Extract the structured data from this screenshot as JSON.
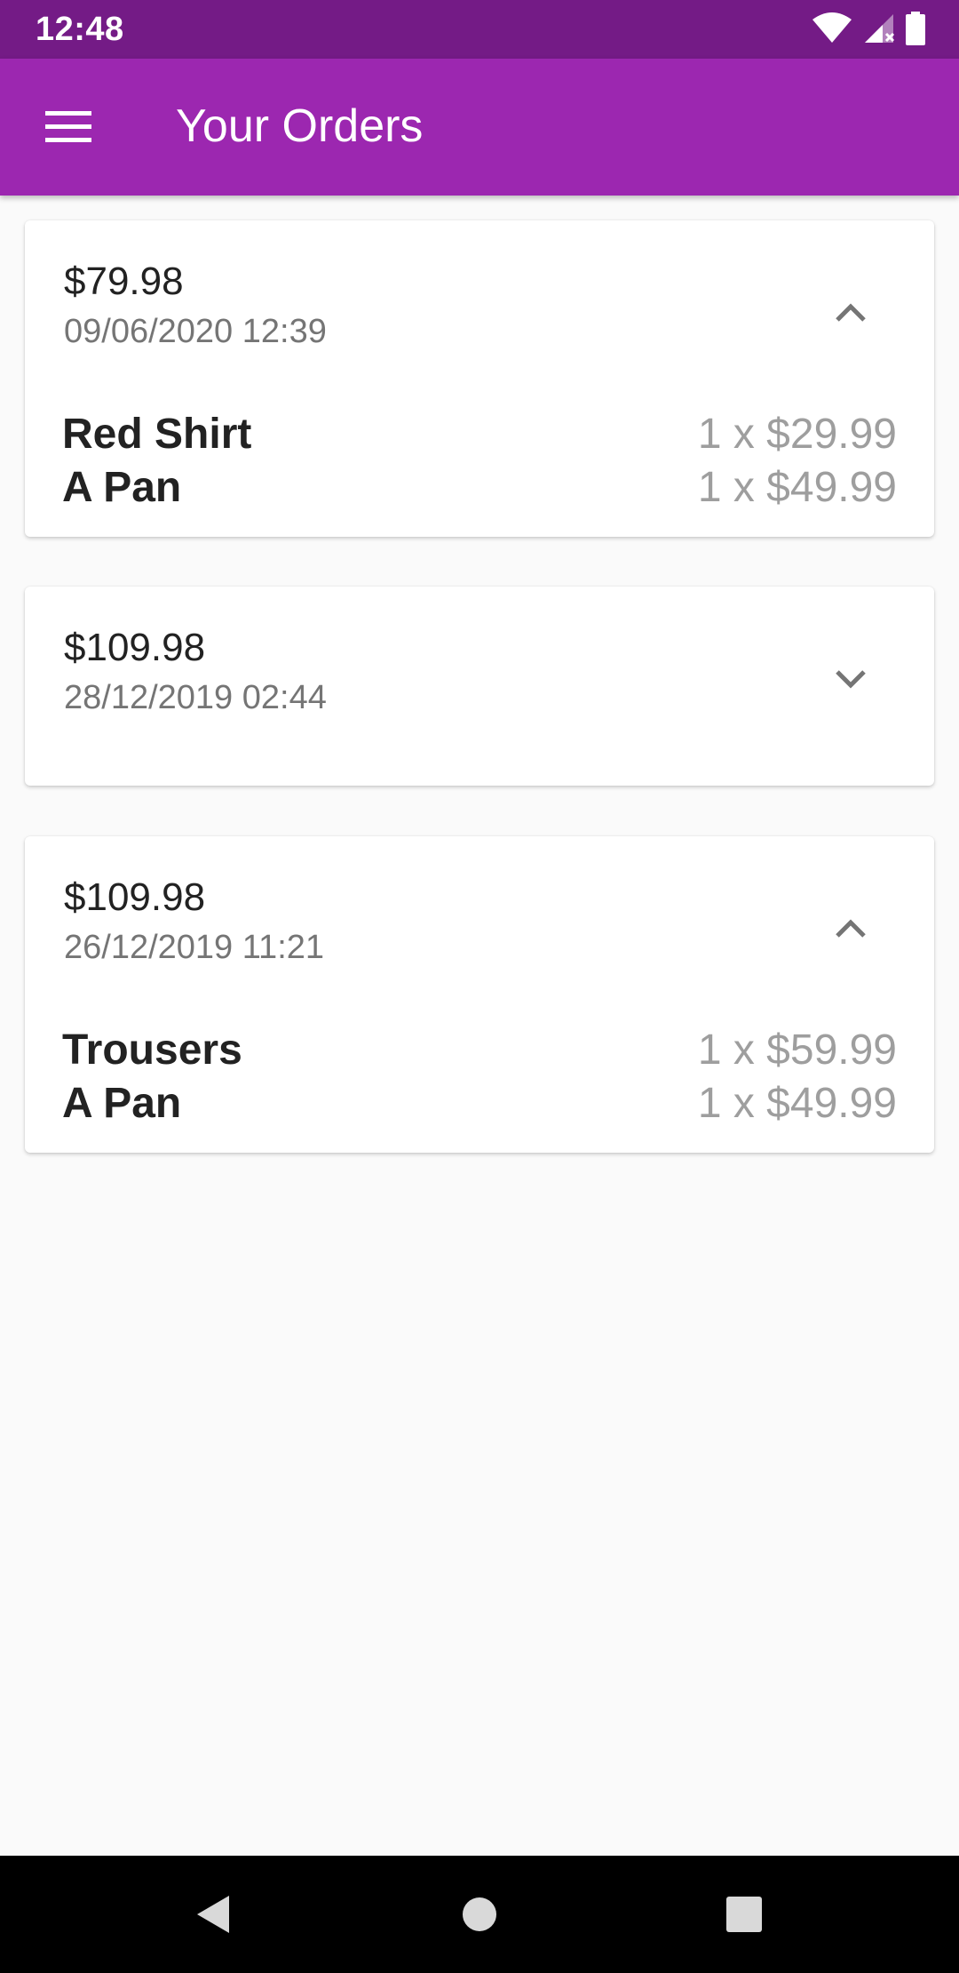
{
  "status_bar": {
    "time": "12:48",
    "icons": [
      "wifi-icon",
      "cell-signal-icon",
      "battery-icon"
    ]
  },
  "app_bar": {
    "title": "Your Orders",
    "menu_icon": "hamburger-menu-icon"
  },
  "colors": {
    "status_bar": "#741b86",
    "app_bar": "#9c27b0",
    "background": "#fafafa"
  },
  "orders": [
    {
      "total": "$79.98",
      "date": "09/06/2020 12:39",
      "expanded": true,
      "toggle_icon": "chevron-up-icon",
      "items": [
        {
          "name": "Red Shirt",
          "qty": "1 x $29.99"
        },
        {
          "name": "A Pan",
          "qty": "1 x $49.99"
        }
      ]
    },
    {
      "total": "$109.98",
      "date": "28/12/2019 02:44",
      "expanded": false,
      "toggle_icon": "chevron-down-icon",
      "items": []
    },
    {
      "total": "$109.98",
      "date": "26/12/2019 11:21",
      "expanded": true,
      "toggle_icon": "chevron-up-icon",
      "items": [
        {
          "name": "Trousers",
          "qty": "1 x $59.99"
        },
        {
          "name": "A Pan",
          "qty": "1 x $49.99"
        }
      ]
    }
  ],
  "nav_bar": {
    "buttons": [
      "back-icon",
      "home-icon",
      "recents-icon"
    ]
  }
}
